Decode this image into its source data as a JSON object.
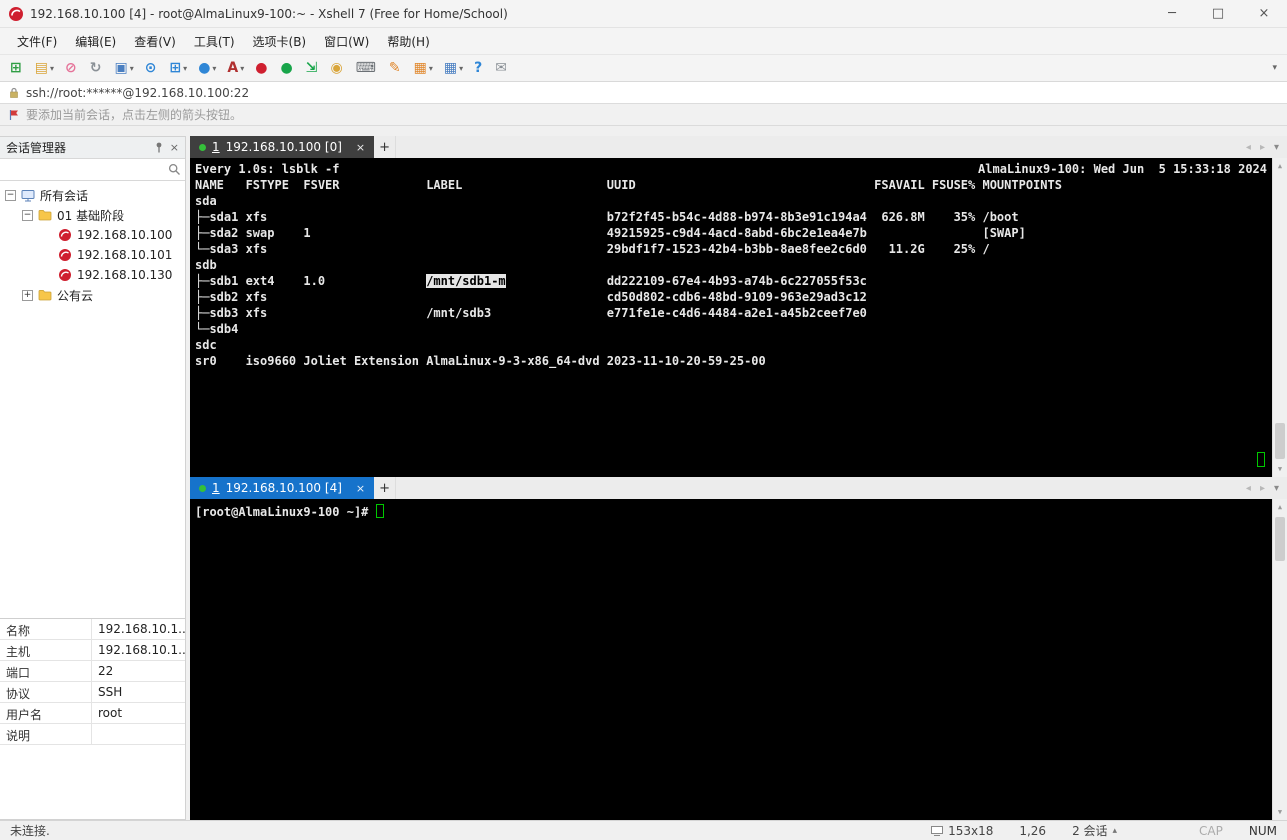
{
  "window": {
    "title": "192.168.10.100 [4] - root@AlmaLinux9-100:~ - Xshell 7 (Free for Home/School)",
    "controls": {
      "minimize": "─",
      "maximize": "□",
      "close": "×"
    }
  },
  "menu": {
    "items": [
      {
        "name": "menu-file",
        "label": "文件(F)"
      },
      {
        "name": "menu-edit",
        "label": "编辑(E)"
      },
      {
        "name": "menu-view",
        "label": "查看(V)"
      },
      {
        "name": "menu-tools",
        "label": "工具(T)"
      },
      {
        "name": "menu-tabs",
        "label": "选项卡(B)"
      },
      {
        "name": "menu-window",
        "label": "窗口(W)"
      },
      {
        "name": "menu-help",
        "label": "帮助(H)"
      }
    ]
  },
  "toolbar": {
    "items": [
      {
        "name": "new-session-button",
        "glyph": "⊞",
        "color": "#2f9e44",
        "dd": ""
      },
      {
        "name": "open-session-button",
        "glyph": "▤",
        "color": "#d9a53a",
        "dd": "▾"
      },
      {
        "name": "disconnect-button",
        "glyph": "⊘",
        "color": "#e57399",
        "dd": ""
      },
      {
        "name": "reconnect-button",
        "glyph": "↻",
        "color": "#8a9096",
        "dd": ""
      },
      {
        "name": "session-dialog-button",
        "glyph": "▣",
        "color": "#4a7fc1",
        "dd": "▾"
      },
      {
        "name": "find-button",
        "glyph": "⊙",
        "color": "#2f86d6",
        "dd": ""
      },
      {
        "name": "new-window-button",
        "glyph": "⊞",
        "color": "#2f86d6",
        "dd": "▾"
      },
      {
        "name": "web-tools-button",
        "glyph": "●",
        "color": "#2f86d6",
        "dd": "▾"
      },
      {
        "name": "font-button",
        "glyph": "A",
        "color": "#b03030",
        "dd": "▾"
      },
      {
        "name": "xshell-button",
        "glyph": "●",
        "color": "#cf1f2f",
        "dd": ""
      },
      {
        "name": "xftp-transfer-button",
        "glyph": "●",
        "color": "#18a54a",
        "dd": ""
      },
      {
        "name": "fullscreen-button",
        "glyph": "⇲",
        "color": "#18a54a",
        "dd": ""
      },
      {
        "name": "lock-screen-button",
        "glyph": "◉",
        "color": "#d9a53a",
        "dd": ""
      },
      {
        "name": "virtual-keyboard-button",
        "glyph": "⌨",
        "color": "#6b7075",
        "dd": ""
      },
      {
        "name": "compose-button",
        "glyph": "✎",
        "color": "#e0862a",
        "dd": ""
      },
      {
        "name": "send-to-all-button",
        "glyph": "▦",
        "color": "#e0862a",
        "dd": "▾"
      },
      {
        "name": "layout-button",
        "glyph": "▦",
        "color": "#4a7fc1",
        "dd": "▾"
      },
      {
        "name": "help-button",
        "glyph": "?",
        "color": "#2f86d6",
        "dd": ""
      },
      {
        "name": "feedback-button",
        "glyph": "✉",
        "color": "#8a9096",
        "dd": ""
      }
    ],
    "overflow_glyph": "▾"
  },
  "addressbar": {
    "url": "ssh://root:******@192.168.10.100:22"
  },
  "infobar": {
    "text": "要添加当前会话，点击左侧的箭头按钮。"
  },
  "session_manager": {
    "title": "会话管理器",
    "close_glyph": "×",
    "tree": {
      "root_label": "所有会话",
      "folder1_label": "01 基础阶段",
      "folder2_label": "公有云",
      "expanded_glyph": "−",
      "collapsed_glyph": "+",
      "sessions": [
        "192.168.10.100",
        "192.168.10.101",
        "192.168.10.130"
      ]
    },
    "properties": [
      {
        "label": "名称",
        "value": "192.168.10.1..."
      },
      {
        "label": "主机",
        "value": "192.168.10.1..."
      },
      {
        "label": "端口",
        "value": "22"
      },
      {
        "label": "协议",
        "value": "SSH"
      },
      {
        "label": "用户名",
        "value": "root"
      },
      {
        "label": "说明",
        "value": ""
      }
    ]
  },
  "panes": {
    "top": {
      "tab_num": "1",
      "tab_label": "192.168.10.100 [0]",
      "header_left": "Every 1.0s: lsblk -f",
      "header_right": "AlmaLinux9-100: Wed Jun  5 15:33:18 2024",
      "lines": [
        {
          "pre": ""
        },
        {
          "pre": "NAME   FSTYPE  FSVER            LABEL                    UUID                                 FSAVAIL FSUSE% MOUNTPOINTS"
        },
        {
          "pre": "sda"
        },
        {
          "pre": "├─sda1 xfs                                               b72f2f45-b54c-4d88-b974-8b3e91c194a4  626.8M    35% /boot"
        },
        {
          "pre": "├─sda2 swap    1                                         49215925-c9d4-4acd-8abd-6bc2e1ea4e7b                [SWAP]"
        },
        {
          "pre": "└─sda3 xfs                                               29bdf1f7-1523-42b4-b3bb-8ae8fee2c6d0   11.2G    25% /"
        },
        {
          "pre": "sdb"
        },
        {
          "pre": "├─sdb1 ext4    1.0              ",
          "sel": "/mnt/sdb1-m",
          "post": "              dd222109-67e4-4b93-a74b-6c227055f53c"
        },
        {
          "pre": "├─sdb2 xfs                                               cd50d802-cdb6-48bd-9109-963e29ad3c12"
        },
        {
          "pre": "├─sdb3 xfs                      /mnt/sdb3                e771fe1e-c4d6-4484-a2e1-a45b2ceef7e0"
        },
        {
          "pre": "└─sdb4"
        },
        {
          "pre": "sdc"
        },
        {
          "pre": "sr0    iso9660 Joliet Extension AlmaLinux-9-3-x86_64-dvd 2023-11-10-20-59-25-00"
        }
      ]
    },
    "bottom": {
      "tab_num": "1",
      "tab_label": "192.168.10.100 [4]",
      "prompt": "[root@AlmaLinux9-100 ~]# "
    }
  },
  "glyphs": {
    "tab_close": "×",
    "new_tab": "+",
    "nav_left": "◂",
    "nav_right": "▸",
    "nav_down": "▾",
    "scroll_up": "▲",
    "scroll_down": "▼",
    "sessions_up": "▴"
  },
  "statusbar": {
    "left": "未连接.",
    "terminal_size": "153x18",
    "cursor_position": "1,26",
    "session_count": "2 会话",
    "caps_indicator": "CAP",
    "num_indicator": "NUM"
  },
  "colors": {
    "tab_active_top": "#3f3f3f",
    "tab_active_bottom": "#1673cb",
    "terminal_bg": "#000000",
    "terminal_fg": "#e8e8e8",
    "cursor_green": "#00c800",
    "selection_bg": "#e6e6e6",
    "connected_dot": "#35c03a",
    "xshell_red": "#cf1f2f",
    "folder_yellow": "#f7c64a"
  }
}
